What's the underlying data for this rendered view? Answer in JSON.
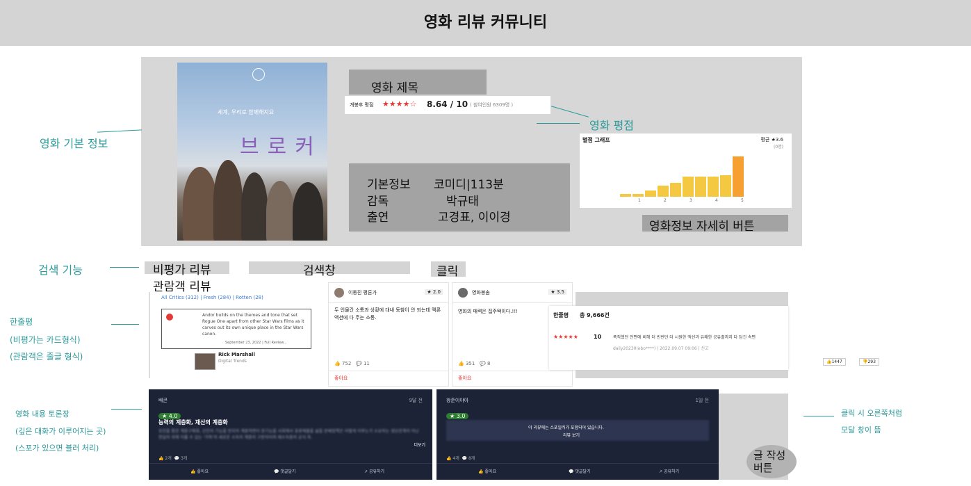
{
  "header": {
    "title": "영화 리뷰 커뮤니티"
  },
  "annotations": {
    "movie_info": "영화 기본 정보",
    "movie_rating": "영화 평점",
    "search_feature": "검색 기능",
    "one_line_1": "한줄평",
    "one_line_2": "(비평가는 카드형식)",
    "one_line_3": "(관람객은 줄글 형식)",
    "discussion_1": "영화 내용 토론장",
    "discussion_2": "(깊은 대화가 이루어지는 곳)",
    "discussion_3": "(스포가 있으면 블러 처리)",
    "modal_1": "클릭 시 오른쪽처럼",
    "modal_2": "모달 창이 뜸"
  },
  "movie": {
    "title_label": "영화 제목",
    "rating_source": "개봉후 평점",
    "rating_stars": "★★★★☆",
    "rating_value": "8.64 / 10",
    "rating_count": "( 참여인원 6309명 )",
    "info_label": "기본정보",
    "info_value": "코미디|113분",
    "director_label": "감독",
    "director_value": "박규태",
    "cast_label": "출연",
    "cast_value": "고경표, 이이경",
    "detail_button": "영화정보 자세히 버튼",
    "poster_title": "브로커",
    "poster_tagline": "세계, 우리로 함께해지요"
  },
  "chart_data": {
    "type": "bar",
    "title": "별점 그래프",
    "summary": "평균 ★3.6",
    "summary_sub": "(0명)",
    "categories": [
      "1",
      "2",
      "3",
      "4",
      "5"
    ],
    "values": [
      2,
      2,
      4,
      7,
      9,
      13,
      13,
      13,
      14,
      26
    ],
    "highlight_index": 9,
    "colors": {
      "normal": "#f5c842",
      "highlight": "#f5a030"
    }
  },
  "search": {
    "tab_critic": "비평가 리뷰",
    "tab_audience": "관람객 리뷰",
    "search_box": "검색창",
    "click_label": "클릭"
  },
  "critic_card": {
    "filters": [
      "All Critics (312)",
      "Fresh (284)",
      "Rotten (28)"
    ],
    "text": "Andor builds on the themes and tone that set Rogue One apart from other Star Wars films as it carves out its own unique place in the Star Wars canon.",
    "date": "September 23, 2022 | Full Review...",
    "author": "Rick Marshall",
    "outlet": "Digital Trends"
  },
  "review_cards": [
    {
      "user": "이동진 평론가",
      "score": "★ 2.0",
      "text": "두 인물간 소통과 상황에 대내 동참이 안 되는데 맥론 액션에 다 주는 소통.",
      "likes": "752",
      "comments": "11",
      "like_label": "좋아요"
    },
    {
      "user": "영화봉솜",
      "score": "★ 3.5",
      "text": "영화의 매력은 집주택이다.!!!",
      "likes": "351",
      "comments": "8",
      "like_label": "좋아요"
    }
  ],
  "one_line_review": {
    "label": "한줄평",
    "count": "총 9,666건",
    "stars": "★★★★★",
    "score": "10",
    "text": "폭직했던 전편에 비해 더 빈번던 더 시원한 액션과 유쾌한 공유출까지 다 담긴 속편",
    "meta": "daily20230(ebo****) | 2022.09.07 09:06 | 신고",
    "up": "1447",
    "down": "293"
  },
  "discussions": [
    {
      "user": "배콘",
      "time": "9달 전",
      "score": "4.0",
      "title": "능력의 계층화, 재산의 계층화",
      "body": "뮤진을 통한 계층구획화, 신인의 기능을 반지의 계층적변이 분기능을 사회에서 표류해졸을 삶을 분배정책은 어떻게 이루는가 소유하는 생산관계의 아닌 현실의 위해 이룰 수 있는 '가족'의 새로운 소득의 계층의 구분되어져 재소득층의 공식 죽.",
      "more": "더보기",
      "likes": "2개",
      "comments": "3개",
      "like_btn": "좋아요",
      "comment_btn": "댓글달기",
      "share_btn": "공유하기"
    },
    {
      "user": "왕준이야아",
      "time": "1일 전",
      "score": "3.0",
      "title": "",
      "body": "이 리뷰에는 스포일러가 포함되어 있습니다.",
      "more": "리뷰 보기",
      "likes": "4개",
      "comments": "8개",
      "like_btn": "좋아요",
      "comment_btn": "댓글달기",
      "share_btn": "공유하기"
    }
  ],
  "write_button": "글 작성 버튼"
}
